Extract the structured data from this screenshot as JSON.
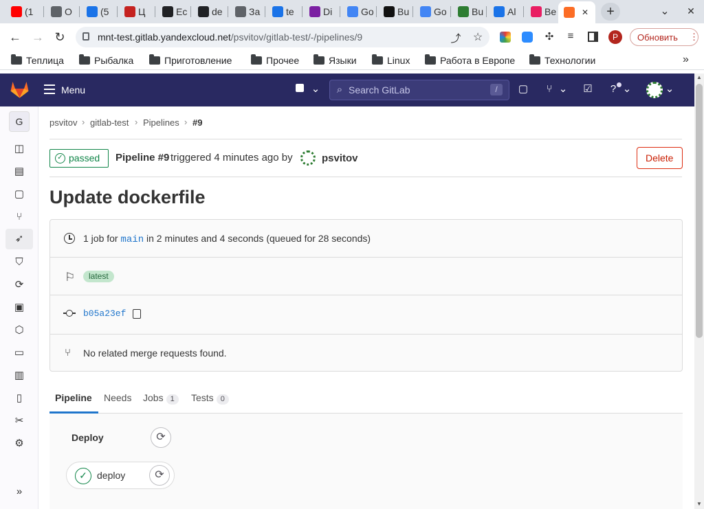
{
  "browser": {
    "tabs": [
      {
        "label": "(1",
        "color": "#ff0000"
      },
      {
        "label": "O",
        "color": "#5f6368"
      },
      {
        "label": "(5",
        "color": "#1a73e8"
      },
      {
        "label": "Ц",
        "color": "#c5221f"
      },
      {
        "label": "Ec",
        "color": "#202124"
      },
      {
        "label": "de",
        "color": "#202124"
      },
      {
        "label": "За",
        "color": "#5f6368"
      },
      {
        "label": "te",
        "color": "#1a73e8"
      },
      {
        "label": "Di",
        "color": "#7b1fa2"
      },
      {
        "label": "Go",
        "color": "#4285f4"
      },
      {
        "label": "Bu",
        "color": "#111111"
      },
      {
        "label": "Go",
        "color": "#4285f4"
      },
      {
        "label": "Bu",
        "color": "#2e7d32"
      },
      {
        "label": "Al",
        "color": "#1a73e8"
      },
      {
        "label": "Be",
        "color": "#e91e63"
      }
    ],
    "active_tab_close": "✕",
    "new_tab": "+",
    "tab_menu": "⌄",
    "window_close": "✕",
    "url_host": "mnt-test.gitlab.yandexcloud.net",
    "url_path": "/psvitov/gitlab-test/-/pipelines/9",
    "profile_initial": "P",
    "update_button": "Обновить",
    "bookmarks": [
      "Теплица",
      "Рыбалка",
      "Приготовление",
      "Прочее",
      "Языки",
      "Linux",
      "Работа в Европе",
      "Технологии"
    ],
    "bookmarks_more": "»"
  },
  "gitlab": {
    "menu_label": "Menu",
    "search_placeholder": "Search GitLab",
    "search_shortcut": "/",
    "project_initial": "G",
    "breadcrumb": [
      "psvitov",
      "gitlab-test",
      "Pipelines",
      "#9"
    ],
    "status": "passed",
    "pipeline_title": "Pipeline #9",
    "triggered_text": "triggered 4 minutes ago by",
    "user": "psvitov",
    "delete_label": "Delete",
    "commit_title": "Update dockerfile",
    "info_jobs_prefix": "1 job for",
    "branch": "main",
    "info_jobs_suffix": "in 2 minutes and 4 seconds (queued for 28 seconds)",
    "tag_latest": "latest",
    "commit_sha": "b05a23ef",
    "no_mr_text": "No related merge requests found.",
    "tabs": [
      {
        "label": "Pipeline",
        "count": ""
      },
      {
        "label": "Needs",
        "count": ""
      },
      {
        "label": "Jobs",
        "count": "1"
      },
      {
        "label": "Tests",
        "count": "0"
      }
    ],
    "stage_name": "Deploy",
    "job_name": "deploy"
  },
  "colors": {
    "header_bg": "#292961",
    "success": "#108548",
    "danger": "#dd2b0e",
    "link": "#1f75cb"
  }
}
